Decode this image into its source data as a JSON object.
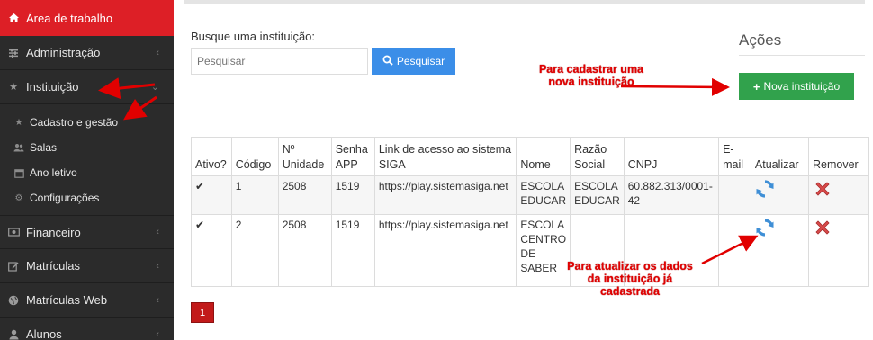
{
  "sidebar": {
    "items": [
      {
        "label": "Área de trabalho",
        "icon": "home-icon"
      },
      {
        "label": "Administração",
        "icon": "sliders-icon"
      },
      {
        "label": "Instituição",
        "icon": "star-icon"
      },
      {
        "label": "Financeiro",
        "icon": "money-icon"
      },
      {
        "label": "Matrículas",
        "icon": "edit-icon"
      },
      {
        "label": "Matrículas Web",
        "icon": "globe-icon"
      },
      {
        "label": "Alunos",
        "icon": "user-icon"
      }
    ],
    "subitems": [
      {
        "label": "Cadastro e gestão",
        "icon": "star-icon"
      },
      {
        "label": "Salas",
        "icon": "group-icon"
      },
      {
        "label": "Ano letivo",
        "icon": "calendar-icon"
      },
      {
        "label": "Configurações",
        "icon": "cogs-icon"
      }
    ]
  },
  "search": {
    "label": "Busque uma instituição:",
    "placeholder": "Pesquisar",
    "button": "Pesquisar"
  },
  "actions": {
    "title": "Ações",
    "new_button": "Nova instituição"
  },
  "table": {
    "headers": [
      "Ativo?",
      "Código",
      "Nº Unidade",
      "Senha APP",
      "Link de acesso ao sistema SIGA",
      "Nome",
      "Razão Social",
      "CNPJ",
      "E-mail",
      "Atualizar",
      "Remover"
    ],
    "rows": [
      {
        "ativo": "✔",
        "codigo": "1",
        "unidade": "2508",
        "senha": "1519",
        "link": "https://play.sistemasiga.net",
        "nome": "ESCOLA EDUCAR",
        "razao": "ESCOLA EDUCAR",
        "cnpj": "60.882.313/0001-42",
        "email": ""
      },
      {
        "ativo": "✔",
        "codigo": "2",
        "unidade": "2508",
        "senha": "1519",
        "link": "https://play.sistemasiga.net",
        "nome": "ESCOLA CENTRO DE SABER",
        "razao": "",
        "cnpj": "",
        "email": ""
      }
    ]
  },
  "pagination": {
    "current": "1"
  },
  "annotations": {
    "register": "Para cadastrar uma nova instituição",
    "update": "Para atualizar os dados da instituição já cadastrada"
  },
  "colors": {
    "sidebar_bg": "#2b2b2b",
    "active_red": "#dd1f26",
    "search_blue": "#3b8ee8",
    "new_green": "#31a24c",
    "annotation_red": "#e10000"
  }
}
